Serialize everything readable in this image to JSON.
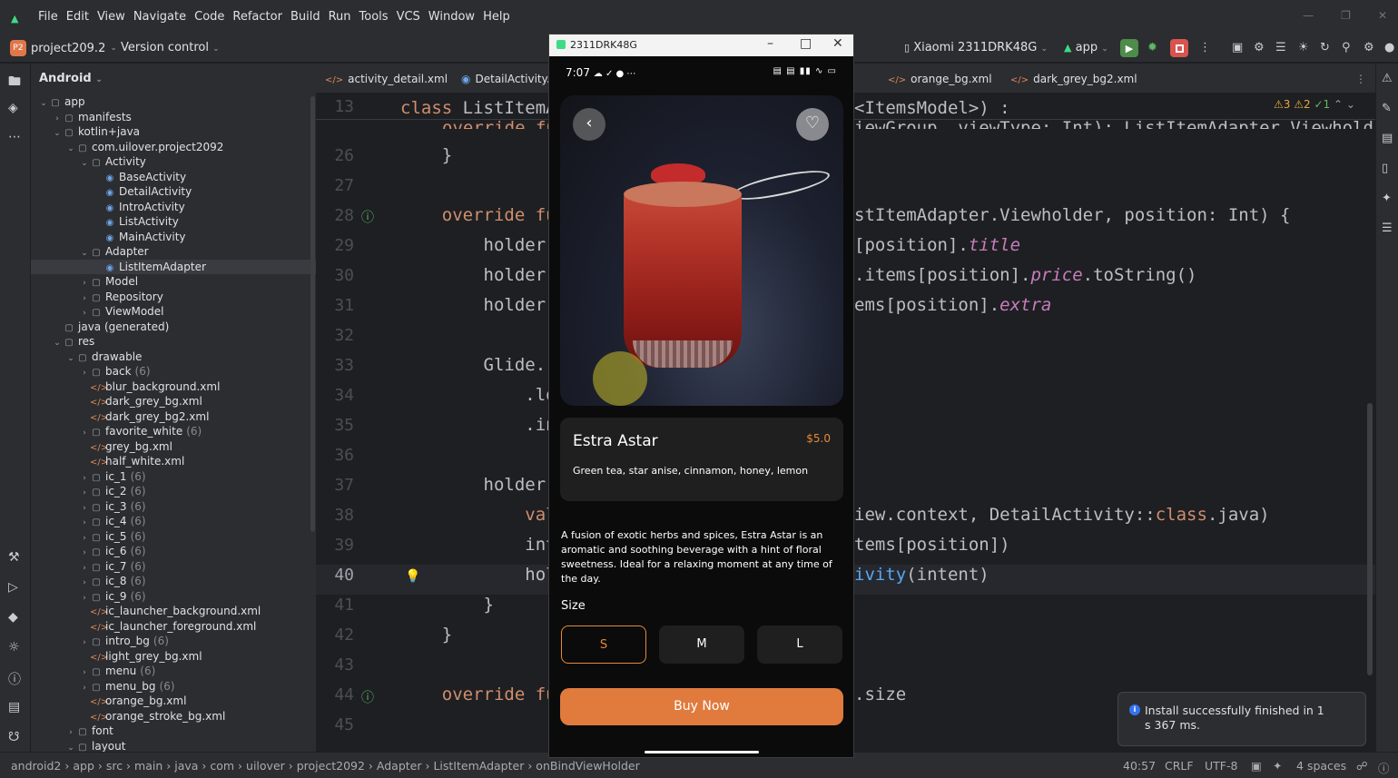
{
  "menubar": {
    "items": [
      "File",
      "Edit",
      "View",
      "Navigate",
      "Code",
      "Refactor",
      "Build",
      "Run",
      "Tools",
      "VCS",
      "Window",
      "Help"
    ]
  },
  "toolbar": {
    "project_badge": "P2",
    "project_name": "project209.2",
    "version_control": "Version control",
    "device": "Xiaomi 2311DRK48G",
    "run_config": "app"
  },
  "project_panel": {
    "view": "Android",
    "tree": [
      {
        "label": "app",
        "type": "folder",
        "indent": 0,
        "arrow": "v"
      },
      {
        "label": "manifests",
        "type": "folder",
        "indent": 1,
        "arrow": ">"
      },
      {
        "label": "kotlin+java",
        "type": "folder",
        "indent": 1,
        "arrow": "v"
      },
      {
        "label": "com.uilover.project2092",
        "type": "folder",
        "indent": 2,
        "arrow": "v"
      },
      {
        "label": "Activity",
        "type": "folder",
        "indent": 3,
        "arrow": "v"
      },
      {
        "label": "BaseActivity",
        "type": "class",
        "indent": 4,
        "arrow": ""
      },
      {
        "label": "DetailActivity",
        "type": "class",
        "indent": 4,
        "arrow": ""
      },
      {
        "label": "IntroActivity",
        "type": "class",
        "indent": 4,
        "arrow": ""
      },
      {
        "label": "ListActivity",
        "type": "class",
        "indent": 4,
        "arrow": ""
      },
      {
        "label": "MainActivity",
        "type": "class",
        "indent": 4,
        "arrow": ""
      },
      {
        "label": "Adapter",
        "type": "folder",
        "indent": 3,
        "arrow": "v"
      },
      {
        "label": "ListItemAdapter",
        "type": "class",
        "indent": 4,
        "arrow": "",
        "selected": true
      },
      {
        "label": "Model",
        "type": "folder",
        "indent": 3,
        "arrow": ">"
      },
      {
        "label": "Repository",
        "type": "folder",
        "indent": 3,
        "arrow": ">"
      },
      {
        "label": "ViewModel",
        "type": "folder",
        "indent": 3,
        "arrow": ">"
      },
      {
        "label": "java (generated)",
        "type": "folder",
        "indent": 1,
        "arrow": ""
      },
      {
        "label": "res",
        "type": "folder",
        "indent": 1,
        "arrow": "v"
      },
      {
        "label": "drawable",
        "type": "folder",
        "indent": 2,
        "arrow": "v"
      },
      {
        "label": "back",
        "count": "(6)",
        "type": "folder",
        "indent": 3,
        "arrow": ">"
      },
      {
        "label": "blur_background.xml",
        "type": "xml",
        "indent": 3,
        "arrow": ""
      },
      {
        "label": "dark_grey_bg.xml",
        "type": "xml",
        "indent": 3,
        "arrow": ""
      },
      {
        "label": "dark_grey_bg2.xml",
        "type": "xml",
        "indent": 3,
        "arrow": ""
      },
      {
        "label": "favorite_white",
        "count": "(6)",
        "type": "folder",
        "indent": 3,
        "arrow": ">"
      },
      {
        "label": "grey_bg.xml",
        "type": "xml",
        "indent": 3,
        "arrow": ""
      },
      {
        "label": "half_white.xml",
        "type": "xml",
        "indent": 3,
        "arrow": ""
      },
      {
        "label": "ic_1",
        "count": "(6)",
        "type": "folder",
        "indent": 3,
        "arrow": ">"
      },
      {
        "label": "ic_2",
        "count": "(6)",
        "type": "folder",
        "indent": 3,
        "arrow": ">"
      },
      {
        "label": "ic_3",
        "count": "(6)",
        "type": "folder",
        "indent": 3,
        "arrow": ">"
      },
      {
        "label": "ic_4",
        "count": "(6)",
        "type": "folder",
        "indent": 3,
        "arrow": ">"
      },
      {
        "label": "ic_5",
        "count": "(6)",
        "type": "folder",
        "indent": 3,
        "arrow": ">"
      },
      {
        "label": "ic_6",
        "count": "(6)",
        "type": "folder",
        "indent": 3,
        "arrow": ">"
      },
      {
        "label": "ic_7",
        "count": "(6)",
        "type": "folder",
        "indent": 3,
        "arrow": ">"
      },
      {
        "label": "ic_8",
        "count": "(6)",
        "type": "folder",
        "indent": 3,
        "arrow": ">"
      },
      {
        "label": "ic_9",
        "count": "(6)",
        "type": "folder",
        "indent": 3,
        "arrow": ">"
      },
      {
        "label": "ic_launcher_background.xml",
        "type": "xml",
        "indent": 3,
        "arrow": ""
      },
      {
        "label": "ic_launcher_foreground.xml",
        "type": "xml",
        "indent": 3,
        "arrow": ""
      },
      {
        "label": "intro_bg",
        "count": "(6)",
        "type": "folder",
        "indent": 3,
        "arrow": ">"
      },
      {
        "label": "light_grey_bg.xml",
        "type": "xml",
        "indent": 3,
        "arrow": ""
      },
      {
        "label": "menu",
        "count": "(6)",
        "type": "folder",
        "indent": 3,
        "arrow": ">"
      },
      {
        "label": "menu_bg",
        "count": "(6)",
        "type": "folder",
        "indent": 3,
        "arrow": ">"
      },
      {
        "label": "orange_bg.xml",
        "type": "xml",
        "indent": 3,
        "arrow": ""
      },
      {
        "label": "orange_stroke_bg.xml",
        "type": "xml",
        "indent": 3,
        "arrow": ""
      },
      {
        "label": "font",
        "type": "folder",
        "indent": 2,
        "arrow": ">"
      },
      {
        "label": "layout",
        "type": "folder",
        "indent": 2,
        "arrow": "v"
      }
    ]
  },
  "tabs": [
    {
      "label": "activity_detail.xml",
      "kind": "xml"
    },
    {
      "label": "DetailActivity.",
      "kind": "class"
    },
    {
      "label": "orange_bg.xml",
      "kind": "xml"
    },
    {
      "label": "dark_grey_bg2.xml",
      "kind": "xml"
    }
  ],
  "editor": {
    "inspections": {
      "warnings": "3",
      "weak": "2",
      "ok": "1"
    },
    "lines": [
      {
        "n": "13",
        "segs": [
          [
            "kw",
            "class "
          ],
          [
            "",
            "ListItemA"
          ]
        ],
        "tail": [
          [
            "",
            "<ItemsModel>) :"
          ]
        ]
      },
      {
        "n": "26",
        "segs": [
          [
            "",
            "    }"
          ]
        ]
      },
      {
        "n": "27",
        "segs": []
      },
      {
        "n": "28",
        "segs": [
          [
            "kw",
            "    override "
          ],
          [
            "kw",
            "fu"
          ]
        ],
        "tail": [
          [
            "",
            "stItemAdapter."
          ],
          [
            "",
            "Viewholder, position: Int) {"
          ]
        ]
      },
      {
        "n": "29",
        "segs": [
          [
            "",
            "        holder."
          ]
        ],
        "tail": [
          [
            "",
            "[position]."
          ],
          [
            "pr",
            "title"
          ]
        ]
      },
      {
        "n": "30",
        "segs": [
          [
            "",
            "        holder."
          ]
        ],
        "tail": [
          [
            "",
            ".items[position]."
          ],
          [
            "pr",
            "price"
          ],
          [
            "",
            ".toString()"
          ]
        ]
      },
      {
        "n": "31",
        "segs": [
          [
            "",
            "        holder."
          ]
        ],
        "tail": [
          [
            "",
            "ems[position]."
          ],
          [
            "pr",
            "extra"
          ]
        ]
      },
      {
        "n": "32",
        "segs": []
      },
      {
        "n": "33",
        "segs": [
          [
            "",
            "        Glide."
          ]
        ],
        "tail": []
      },
      {
        "n": "34",
        "segs": [
          [
            "",
            "            .lo"
          ]
        ],
        "tail": []
      },
      {
        "n": "35",
        "segs": [
          [
            "",
            "            .in"
          ]
        ],
        "tail": []
      },
      {
        "n": "36",
        "segs": []
      },
      {
        "n": "37",
        "segs": [
          [
            "",
            "        holder."
          ]
        ],
        "tail": []
      },
      {
        "n": "38",
        "segs": [
          [
            "kw",
            "            val"
          ]
        ],
        "tail": [
          [
            "",
            "iew.context, DetailActivity::"
          ],
          [
            "kw",
            "class"
          ],
          [
            "",
            ".java)"
          ]
        ]
      },
      {
        "n": "39",
        "segs": [
          [
            "",
            "            int"
          ]
        ],
        "tail": [
          [
            "",
            "tems[position])"
          ]
        ]
      },
      {
        "n": "40",
        "segs": [
          [
            "",
            "            hol"
          ]
        ],
        "tail": [
          [
            "fn",
            "ivity"
          ],
          [
            "",
            "(intent)"
          ]
        ]
      },
      {
        "n": "41",
        "segs": [
          [
            "",
            "        }"
          ]
        ]
      },
      {
        "n": "42",
        "segs": [
          [
            "",
            "    }"
          ]
        ]
      },
      {
        "n": "43",
        "segs": []
      },
      {
        "n": "44",
        "segs": [
          [
            "kw",
            "    override "
          ],
          [
            "kw",
            "fu"
          ]
        ],
        "tail": [
          [
            "",
            ".size"
          ]
        ]
      },
      {
        "n": "45",
        "segs": []
      }
    ],
    "sticky": {
      "left": "override fu",
      "right": "iewGroup, viewType: Int): ListItemAdapter.Viewhold"
    }
  },
  "emulator": {
    "title": "2311DRK48G",
    "status_time": "7:07",
    "product_name": "Estra Astar",
    "price": "$5.0",
    "ingredients": "Green tea, star anise, cinnamon, honey, lemon",
    "description": "A fusion of exotic herbs and spices, Estra Astar is an aromatic and soothing beverage with a hint of floral sweetness. Ideal for a relaxing moment at any time of the day.",
    "size_label": "Size",
    "sizes": [
      "S",
      "M",
      "L"
    ],
    "selected_size": "S",
    "buy_label": "Buy Now"
  },
  "toast": {
    "text": "Install successfully finished in 1 s 367 ms."
  },
  "statusbar": {
    "crumbs": [
      "android2",
      "app",
      "src",
      "main",
      "java",
      "com",
      "uilover",
      "project2092",
      "Adapter",
      "ListItemAdapter",
      "onBindViewHolder"
    ],
    "position": "40:57",
    "line_sep": "CRLF",
    "encoding": "UTF-8",
    "indent": "4 spaces"
  },
  "colors": {
    "accent": "#e07b3d",
    "ide_bg": "#1e1f22",
    "panel_bg": "#2b2d30",
    "keyword": "#cf8e6d",
    "property": "#c77dbb"
  }
}
